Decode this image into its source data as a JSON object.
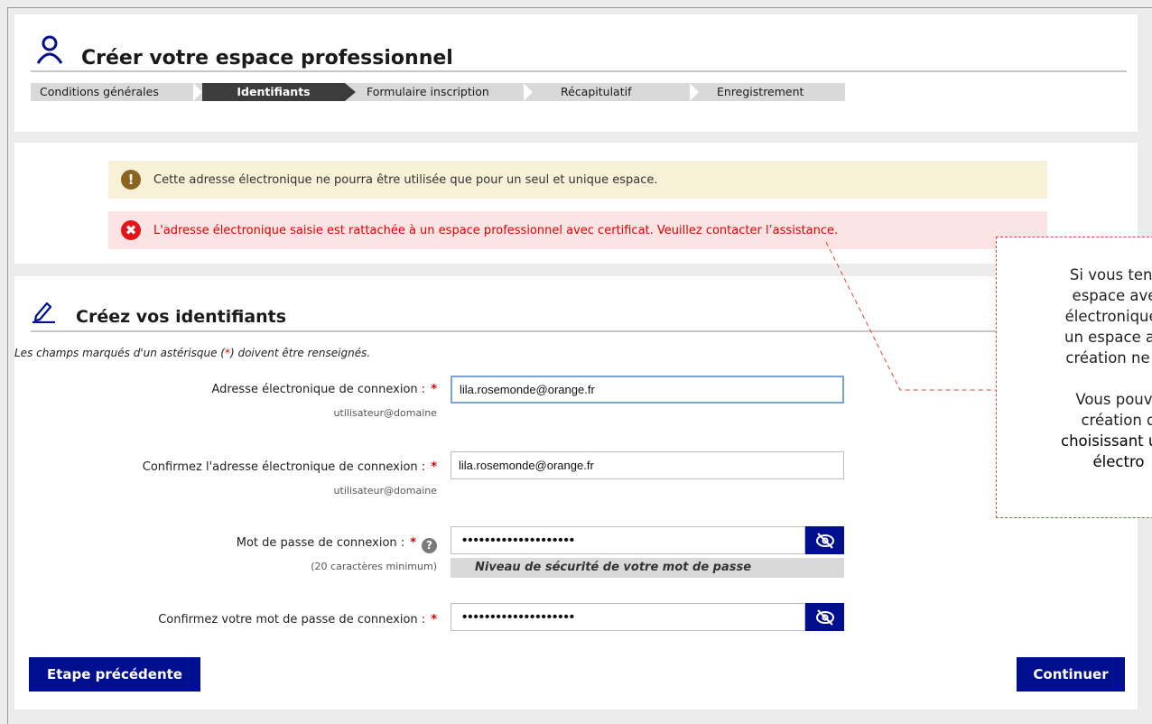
{
  "header": {
    "title": "Créer votre espace professionnel",
    "steps": [
      {
        "label": "Conditions générales",
        "active": false
      },
      {
        "label": "Identifiants",
        "active": true
      },
      {
        "label": "Formulaire inscription",
        "active": false
      },
      {
        "label": "Récapitulatif",
        "active": false
      },
      {
        "label": "Enregistrement",
        "active": false
      }
    ]
  },
  "alerts": {
    "warning": "Cette adresse électronique ne pourra être utilisée que pour un seul et unique espace.",
    "error": "L'adresse électronique saisie est rattachée à un espace professionnel avec certificat. Veuillez contacter l’assistance."
  },
  "form": {
    "title": "Créez vos identifiants",
    "required_note_prefix": "Les champs marqués d'un astérisque (",
    "required_note_star": "*",
    "required_note_suffix": ") doivent être renseignés.",
    "email_label": "Adresse électronique de connexion :",
    "email_value": "lila.rosemonde@orange.fr",
    "email_hint": "utilisateur@domaine",
    "confirm_email_label": "Confirmez l'adresse électronique de connexion :",
    "confirm_email_value": "lila.rosemonde@orange.fr",
    "confirm_email_hint": "utilisateur@domaine",
    "password_label": "Mot de passe de connexion :",
    "password_value": "••••••••••••••••••••",
    "password_hint": "(20 caractères minimum)",
    "strength_label": "Niveau de sécurité de votre mot de passe",
    "confirm_password_label": "Confirmez votre mot de passe de connexion :",
    "confirm_password_value": "••••••••••••••••••••",
    "required_star": "*",
    "help_glyph": "?"
  },
  "buttons": {
    "previous": "Etape précédente",
    "continue": "Continuer"
  },
  "callout": {
    "line1": "Si vous tente",
    "line2": "espace avec",
    "line3": "électronique d",
    "line4": "un espace ave",
    "line5": "création ne se",
    "line6": "Vous pouve",
    "line7": "création d",
    "line8": "choisissant une",
    "line9": "électro"
  },
  "colors": {
    "primary_button": "#000f8e",
    "error_text": "#e00000",
    "error_bg": "#fce4e4",
    "warning_bg": "#f6f1d7",
    "active_step": "#3c3c3c"
  },
  "icons": {
    "header": "person-icon",
    "section": "pencil-icon",
    "warning": "exclamation-icon",
    "error": "error-x-icon",
    "toggle": "eye-slash-icon"
  }
}
